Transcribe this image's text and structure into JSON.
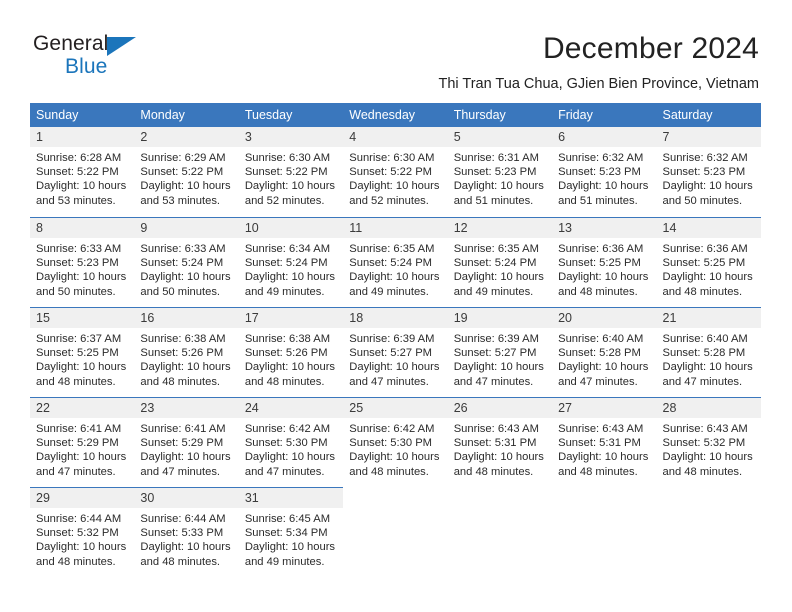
{
  "brand": {
    "name_part1": "General",
    "name_part2": "Blue",
    "accent_color": "#1b75bb"
  },
  "header": {
    "title": "December 2024",
    "subtitle": "Thi Tran Tua Chua, GJien Bien Province, Vietnam"
  },
  "calendar": {
    "header_bg": "#3a77bd",
    "daynum_bg": "#f0f0f0",
    "weekdays": [
      "Sunday",
      "Monday",
      "Tuesday",
      "Wednesday",
      "Thursday",
      "Friday",
      "Saturday"
    ],
    "weeks": [
      [
        {
          "day": "1",
          "sunrise": "Sunrise: 6:28 AM",
          "sunset": "Sunset: 5:22 PM",
          "daylight_line1": "Daylight: 10 hours",
          "daylight_line2": "and 53 minutes."
        },
        {
          "day": "2",
          "sunrise": "Sunrise: 6:29 AM",
          "sunset": "Sunset: 5:22 PM",
          "daylight_line1": "Daylight: 10 hours",
          "daylight_line2": "and 53 minutes."
        },
        {
          "day": "3",
          "sunrise": "Sunrise: 6:30 AM",
          "sunset": "Sunset: 5:22 PM",
          "daylight_line1": "Daylight: 10 hours",
          "daylight_line2": "and 52 minutes."
        },
        {
          "day": "4",
          "sunrise": "Sunrise: 6:30 AM",
          "sunset": "Sunset: 5:22 PM",
          "daylight_line1": "Daylight: 10 hours",
          "daylight_line2": "and 52 minutes."
        },
        {
          "day": "5",
          "sunrise": "Sunrise: 6:31 AM",
          "sunset": "Sunset: 5:23 PM",
          "daylight_line1": "Daylight: 10 hours",
          "daylight_line2": "and 51 minutes."
        },
        {
          "day": "6",
          "sunrise": "Sunrise: 6:32 AM",
          "sunset": "Sunset: 5:23 PM",
          "daylight_line1": "Daylight: 10 hours",
          "daylight_line2": "and 51 minutes."
        },
        {
          "day": "7",
          "sunrise": "Sunrise: 6:32 AM",
          "sunset": "Sunset: 5:23 PM",
          "daylight_line1": "Daylight: 10 hours",
          "daylight_line2": "and 50 minutes."
        }
      ],
      [
        {
          "day": "8",
          "sunrise": "Sunrise: 6:33 AM",
          "sunset": "Sunset: 5:23 PM",
          "daylight_line1": "Daylight: 10 hours",
          "daylight_line2": "and 50 minutes."
        },
        {
          "day": "9",
          "sunrise": "Sunrise: 6:33 AM",
          "sunset": "Sunset: 5:24 PM",
          "daylight_line1": "Daylight: 10 hours",
          "daylight_line2": "and 50 minutes."
        },
        {
          "day": "10",
          "sunrise": "Sunrise: 6:34 AM",
          "sunset": "Sunset: 5:24 PM",
          "daylight_line1": "Daylight: 10 hours",
          "daylight_line2": "and 49 minutes."
        },
        {
          "day": "11",
          "sunrise": "Sunrise: 6:35 AM",
          "sunset": "Sunset: 5:24 PM",
          "daylight_line1": "Daylight: 10 hours",
          "daylight_line2": "and 49 minutes."
        },
        {
          "day": "12",
          "sunrise": "Sunrise: 6:35 AM",
          "sunset": "Sunset: 5:24 PM",
          "daylight_line1": "Daylight: 10 hours",
          "daylight_line2": "and 49 minutes."
        },
        {
          "day": "13",
          "sunrise": "Sunrise: 6:36 AM",
          "sunset": "Sunset: 5:25 PM",
          "daylight_line1": "Daylight: 10 hours",
          "daylight_line2": "and 48 minutes."
        },
        {
          "day": "14",
          "sunrise": "Sunrise: 6:36 AM",
          "sunset": "Sunset: 5:25 PM",
          "daylight_line1": "Daylight: 10 hours",
          "daylight_line2": "and 48 minutes."
        }
      ],
      [
        {
          "day": "15",
          "sunrise": "Sunrise: 6:37 AM",
          "sunset": "Sunset: 5:25 PM",
          "daylight_line1": "Daylight: 10 hours",
          "daylight_line2": "and 48 minutes."
        },
        {
          "day": "16",
          "sunrise": "Sunrise: 6:38 AM",
          "sunset": "Sunset: 5:26 PM",
          "daylight_line1": "Daylight: 10 hours",
          "daylight_line2": "and 48 minutes."
        },
        {
          "day": "17",
          "sunrise": "Sunrise: 6:38 AM",
          "sunset": "Sunset: 5:26 PM",
          "daylight_line1": "Daylight: 10 hours",
          "daylight_line2": "and 48 minutes."
        },
        {
          "day": "18",
          "sunrise": "Sunrise: 6:39 AM",
          "sunset": "Sunset: 5:27 PM",
          "daylight_line1": "Daylight: 10 hours",
          "daylight_line2": "and 47 minutes."
        },
        {
          "day": "19",
          "sunrise": "Sunrise: 6:39 AM",
          "sunset": "Sunset: 5:27 PM",
          "daylight_line1": "Daylight: 10 hours",
          "daylight_line2": "and 47 minutes."
        },
        {
          "day": "20",
          "sunrise": "Sunrise: 6:40 AM",
          "sunset": "Sunset: 5:28 PM",
          "daylight_line1": "Daylight: 10 hours",
          "daylight_line2": "and 47 minutes."
        },
        {
          "day": "21",
          "sunrise": "Sunrise: 6:40 AM",
          "sunset": "Sunset: 5:28 PM",
          "daylight_line1": "Daylight: 10 hours",
          "daylight_line2": "and 47 minutes."
        }
      ],
      [
        {
          "day": "22",
          "sunrise": "Sunrise: 6:41 AM",
          "sunset": "Sunset: 5:29 PM",
          "daylight_line1": "Daylight: 10 hours",
          "daylight_line2": "and 47 minutes."
        },
        {
          "day": "23",
          "sunrise": "Sunrise: 6:41 AM",
          "sunset": "Sunset: 5:29 PM",
          "daylight_line1": "Daylight: 10 hours",
          "daylight_line2": "and 47 minutes."
        },
        {
          "day": "24",
          "sunrise": "Sunrise: 6:42 AM",
          "sunset": "Sunset: 5:30 PM",
          "daylight_line1": "Daylight: 10 hours",
          "daylight_line2": "and 47 minutes."
        },
        {
          "day": "25",
          "sunrise": "Sunrise: 6:42 AM",
          "sunset": "Sunset: 5:30 PM",
          "daylight_line1": "Daylight: 10 hours",
          "daylight_line2": "and 48 minutes."
        },
        {
          "day": "26",
          "sunrise": "Sunrise: 6:43 AM",
          "sunset": "Sunset: 5:31 PM",
          "daylight_line1": "Daylight: 10 hours",
          "daylight_line2": "and 48 minutes."
        },
        {
          "day": "27",
          "sunrise": "Sunrise: 6:43 AM",
          "sunset": "Sunset: 5:31 PM",
          "daylight_line1": "Daylight: 10 hours",
          "daylight_line2": "and 48 minutes."
        },
        {
          "day": "28",
          "sunrise": "Sunrise: 6:43 AM",
          "sunset": "Sunset: 5:32 PM",
          "daylight_line1": "Daylight: 10 hours",
          "daylight_line2": "and 48 minutes."
        }
      ],
      [
        {
          "day": "29",
          "sunrise": "Sunrise: 6:44 AM",
          "sunset": "Sunset: 5:32 PM",
          "daylight_line1": "Daylight: 10 hours",
          "daylight_line2": "and 48 minutes."
        },
        {
          "day": "30",
          "sunrise": "Sunrise: 6:44 AM",
          "sunset": "Sunset: 5:33 PM",
          "daylight_line1": "Daylight: 10 hours",
          "daylight_line2": "and 48 minutes."
        },
        {
          "day": "31",
          "sunrise": "Sunrise: 6:45 AM",
          "sunset": "Sunset: 5:34 PM",
          "daylight_line1": "Daylight: 10 hours",
          "daylight_line2": "and 49 minutes."
        },
        {
          "day": "",
          "sunrise": "",
          "sunset": "",
          "daylight_line1": "",
          "daylight_line2": ""
        },
        {
          "day": "",
          "sunrise": "",
          "sunset": "",
          "daylight_line1": "",
          "daylight_line2": ""
        },
        {
          "day": "",
          "sunrise": "",
          "sunset": "",
          "daylight_line1": "",
          "daylight_line2": ""
        },
        {
          "day": "",
          "sunrise": "",
          "sunset": "",
          "daylight_line1": "",
          "daylight_line2": ""
        }
      ]
    ]
  }
}
